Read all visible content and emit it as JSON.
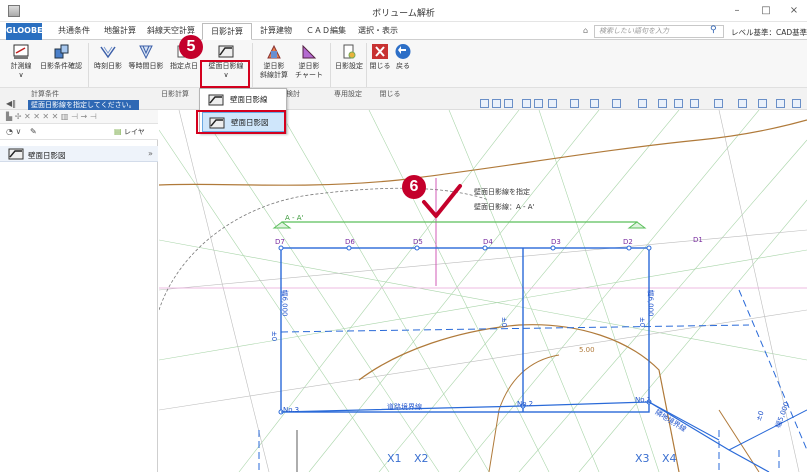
{
  "window": {
    "title": "ボリューム解析",
    "controls": [
      "–",
      "□",
      "×"
    ]
  },
  "menu": {
    "brand": "GLOOBE",
    "tabs": [
      "共通条件",
      "地盤計算",
      "斜線天空計算",
      "日影計算",
      "計算建物",
      "ＣＡＤ編集",
      "選択・表示"
    ],
    "active_tab": "日影計算",
    "search_placeholder": "検索したい語句を入力",
    "level_label": "レベル基準：CAD基準準"
  },
  "ribbon": {
    "buttons": [
      {
        "label": "計測線",
        "sub": "∨"
      },
      {
        "label": "日影条件確認",
        "sub": ""
      },
      {
        "label": "時刻日影",
        "sub": ""
      },
      {
        "label": "等時間日影",
        "sub": ""
      },
      {
        "label": "指定点日",
        "sub": ""
      },
      {
        "label": "壁面日影線",
        "sub": "∨"
      },
      {
        "label": "逆日影",
        "sub": "斜線計算"
      },
      {
        "label": "逆日影",
        "sub": "チャート"
      },
      {
        "label": "日影設定",
        "sub": ""
      },
      {
        "label": "閉じる",
        "sub": ""
      },
      {
        "label": "戻る",
        "sub": ""
      }
    ],
    "groups": [
      "計算条件",
      "日影計算",
      "検討",
      "専用設定",
      "閉じる"
    ],
    "group_sub_suffix": "∨"
  },
  "badges": {
    "step5": "5",
    "step6": "6"
  },
  "dropdown": {
    "items": [
      {
        "label": "壁面日影線"
      },
      {
        "label": "壁面日影図"
      }
    ],
    "selected": 1
  },
  "prompt": "壁面日影線を指定してください。",
  "left_panel": {
    "layer_label": "レイヤ",
    "panel_title": "壁面日影図"
  },
  "canvas": {
    "tooltip_line1": "壁面日影線を指定",
    "tooltip_line2": "壁面日影線：A - A'",
    "section_label": "A - A'",
    "marks": [
      "D7",
      "D6",
      "D5",
      "D4",
      "D3",
      "D2",
      "D1"
    ],
    "pt_labels": [
      "No.3",
      "No.2",
      "No.1"
    ],
    "road_label": "道路境界線",
    "road_label2": "隣地境界線",
    "height_label": "5.00",
    "dims": [
      "±0",
      "±0",
      "幅6,000",
      "±0",
      "幅6,000",
      "±0",
      "幅5,000"
    ],
    "x_labels": [
      "X1",
      "X2",
      "X3",
      "X4"
    ]
  }
}
